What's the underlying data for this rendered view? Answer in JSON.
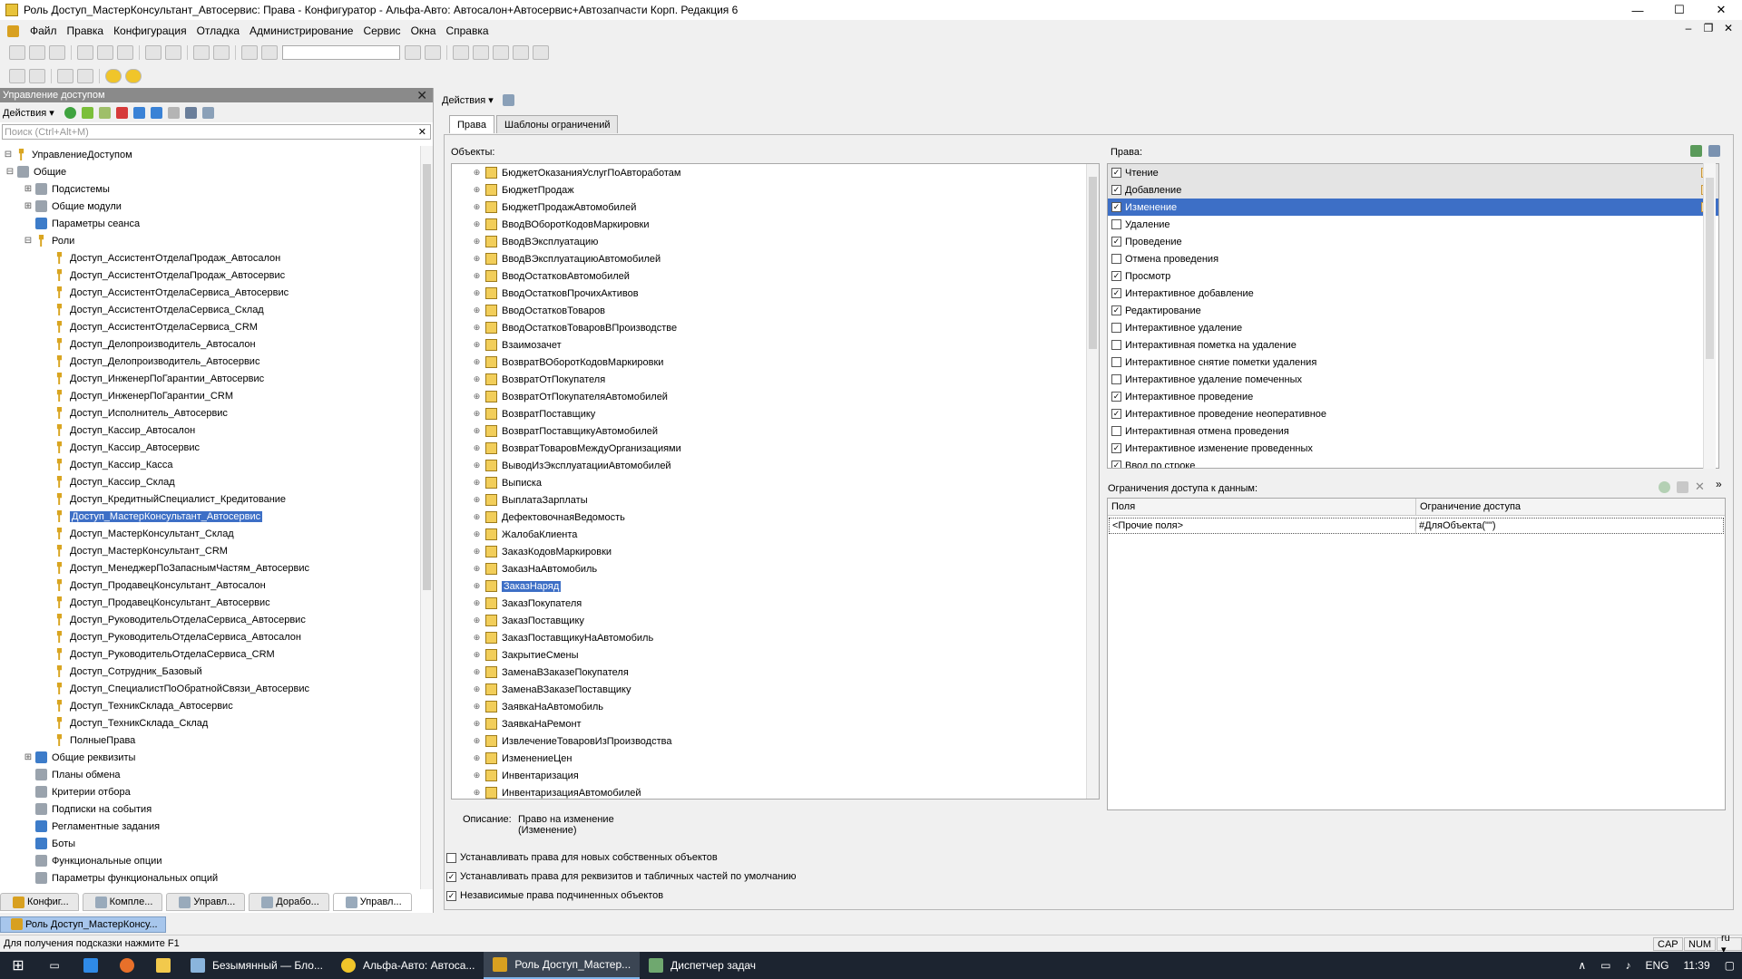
{
  "window": {
    "title": "Роль Доступ_МастерКонсультант_Автосервис: Права - Конфигуратор - Альфа-Авто: Автосалон+Автосервис+Автозапчасти Корп. Редакция 6",
    "minimize": "—",
    "maximize": "☐",
    "close": "✕"
  },
  "menu": [
    "Файл",
    "Правка",
    "Конфигурация",
    "Отладка",
    "Администрирование",
    "Сервис",
    "Окна",
    "Справка"
  ],
  "left_panel": {
    "title": "Управление доступом",
    "close": "✕",
    "actions_label": "Действия ▾",
    "search_placeholder": "Поиск (Ctrl+Alt+M)",
    "search_clear": "✕",
    "tree": {
      "root": "УправлениеДоступом",
      "general": "Общие",
      "subsystems": "Подсистемы",
      "common_modules": "Общие модули",
      "session_params": "Параметры сеанса",
      "roles": "Роли",
      "role_items": [
        "Доступ_АссистентОтделаПродаж_Автосалон",
        "Доступ_АссистентОтделаПродаж_Автосервис",
        "Доступ_АссистентОтделаСервиса_Автосервис",
        "Доступ_АссистентОтделаСервиса_Склад",
        "Доступ_АссистентОтделаСервиса_CRM",
        "Доступ_Делопроизводитель_Автосалон",
        "Доступ_Делопроизводитель_Автосервис",
        "Доступ_ИнженерПоГарантии_Автосервис",
        "Доступ_ИнженерПоГарантии_CRM",
        "Доступ_Исполнитель_Автосервис",
        "Доступ_Кассир_Автосалон",
        "Доступ_Кассир_Автосервис",
        "Доступ_Кассир_Касса",
        "Доступ_Кассир_Склад",
        "Доступ_КредитныйСпециалист_Кредитование",
        "Доступ_МастерКонсультант_Автосервис",
        "Доступ_МастерКонсультант_Склад",
        "Доступ_МастерКонсультант_CRM",
        "Доступ_МенеджерПоЗапаснымЧастям_Автосервис",
        "Доступ_ПродавецКонсультант_Автосалон",
        "Доступ_ПродавецКонсультант_Автосервис",
        "Доступ_РуководительОтделаСервиса_Автосервис",
        "Доступ_РуководительОтделаСервиса_Автосалон",
        "Доступ_РуководительОтделаСервиса_CRM",
        "Доступ_Сотрудник_Базовый",
        "Доступ_СпециалистПоОбратнойСвязи_Автосервис",
        "Доступ_ТехникСклада_Автосервис",
        "Доступ_ТехникСклада_Склад",
        "ПолныеПрава"
      ],
      "selected_role_index": 15,
      "after_roles": [
        "Общие реквизиты",
        "Планы обмена",
        "Критерии отбора",
        "Подписки на события",
        "Регламентные задания",
        "Боты",
        "Функциональные опции",
        "Параметры функциональных опций"
      ]
    },
    "bottom_tabs": [
      "Конфиг...",
      "Компле...",
      "Управл...",
      "Дорабо...",
      "Управл..."
    ]
  },
  "right": {
    "actions_label": "Действия ▾",
    "tabs": [
      "Права",
      "Шаблоны ограничений"
    ],
    "objects_label": "Объекты:",
    "objects": [
      "БюджетОказанияУслугПоАвтоработам",
      "БюджетПродаж",
      "БюджетПродажАвтомобилей",
      "ВводВОборотКодовМаркировки",
      "ВводВЭксплуатацию",
      "ВводВЭксплуатациюАвтомобилей",
      "ВводОстатковАвтомобилей",
      "ВводОстатковПрочихАктивов",
      "ВводОстатковТоваров",
      "ВводОстатковТоваровВПроизводстве",
      "Взаимозачет",
      "ВозвратВОборотКодовМаркировки",
      "ВозвратОтПокупателя",
      "ВозвратОтПокупателяАвтомобилей",
      "ВозвратПоставщику",
      "ВозвратПоставщикуАвтомобилей",
      "ВозвратТоваровМеждуОрганизациями",
      "ВыводИзЭксплуатацииАвтомобилей",
      "Выписка",
      "ВыплатаЗарплаты",
      "ДефектовочнаяВедомость",
      "ЖалобаКлиента",
      "ЗаказКодовМаркировки",
      "ЗаказНаАвтомобиль",
      "ЗаказНаряд",
      "ЗаказПокупателя",
      "ЗаказПоставщику",
      "ЗаказПоставщикуНаАвтомобиль",
      "ЗакрытиеСмены",
      "ЗаменаВЗаказеПокупателя",
      "ЗаменаВЗаказеПоставщику",
      "ЗаявкаНаАвтомобиль",
      "ЗаявкаНаРемонт",
      "ИзвлечениеТоваровИзПроизводства",
      "ИзменениеЦен",
      "Инвентаризация",
      "ИнвентаризацияАвтомобилей"
    ],
    "selected_object_index": 24,
    "description_label": "Описание:",
    "description_line1": "Право на изменение",
    "description_line2": "(Изменение)",
    "rights_label": "Права:",
    "rights": [
      {
        "name": "Чтение",
        "checked": true,
        "shaded": true
      },
      {
        "name": "Добавление",
        "checked": true,
        "shaded": true
      },
      {
        "name": "Изменение",
        "checked": true,
        "selected": true
      },
      {
        "name": "Удаление",
        "checked": false
      },
      {
        "name": "Проведение",
        "checked": true
      },
      {
        "name": "Отмена проведения",
        "checked": false
      },
      {
        "name": "Просмотр",
        "checked": true
      },
      {
        "name": "Интерактивное добавление",
        "checked": true
      },
      {
        "name": "Редактирование",
        "checked": true
      },
      {
        "name": "Интерактивное удаление",
        "checked": false
      },
      {
        "name": "Интерактивная пометка на удаление",
        "checked": false
      },
      {
        "name": "Интерактивное снятие пометки удаления",
        "checked": false
      },
      {
        "name": "Интерактивное удаление помеченных",
        "checked": false
      },
      {
        "name": "Интерактивное проведение",
        "checked": true
      },
      {
        "name": "Интерактивное проведение неоперативное",
        "checked": true
      },
      {
        "name": "Интерактивная отмена проведения",
        "checked": false
      },
      {
        "name": "Интерактивное изменение проведенных",
        "checked": true
      },
      {
        "name": "Ввод по строке",
        "checked": true
      }
    ],
    "restrictions_label": "Ограничения доступа к данным:",
    "restr_col_fields": "Поля",
    "restr_col_restriction": "Ограничение доступа",
    "restr_row_field": "<Прочие поля>",
    "restr_row_value": "#ДляОбъекта(\"\")",
    "check_new_objects": "Устанавливать права для новых собственных объектов",
    "check_attrs": "Устанавливать права для реквизитов и табличных частей по умолчанию",
    "check_independent": "Независимые права подчиненных объектов"
  },
  "doc_window_tab": "Роль Доступ_МастерКонсу...",
  "status": {
    "hint": "Для получения подсказки нажмите F1",
    "cap": "CAP",
    "num": "NUM",
    "lang": "ru ▾"
  },
  "taskbar": {
    "items": [
      "Безымянный — Бло...",
      "Альфа-Авто: Автоса...",
      "Роль Доступ_Мастер...",
      "Диспетчер задач"
    ],
    "active_index": 2,
    "lang": "ENG",
    "time": "11:39"
  }
}
